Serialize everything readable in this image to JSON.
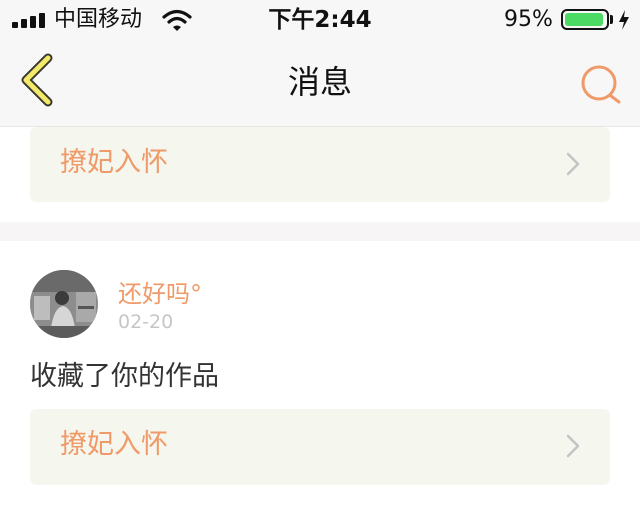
{
  "status_bar": {
    "carrier": "中国移动",
    "time": "下午2:44",
    "battery_percent": "95%",
    "battery_level": 0.95,
    "battery_color": "#4cd964"
  },
  "nav": {
    "title": "消息",
    "back_icon": "chevron-left-icon",
    "search_icon": "search-icon",
    "accent_color": "#ef9a68"
  },
  "messages": [
    {
      "work_title": "撩妃入怀"
    },
    {
      "username": "还好吗°",
      "date": "02-20",
      "action": "收藏了你的作品",
      "work_title": "撩妃入怀"
    }
  ]
}
